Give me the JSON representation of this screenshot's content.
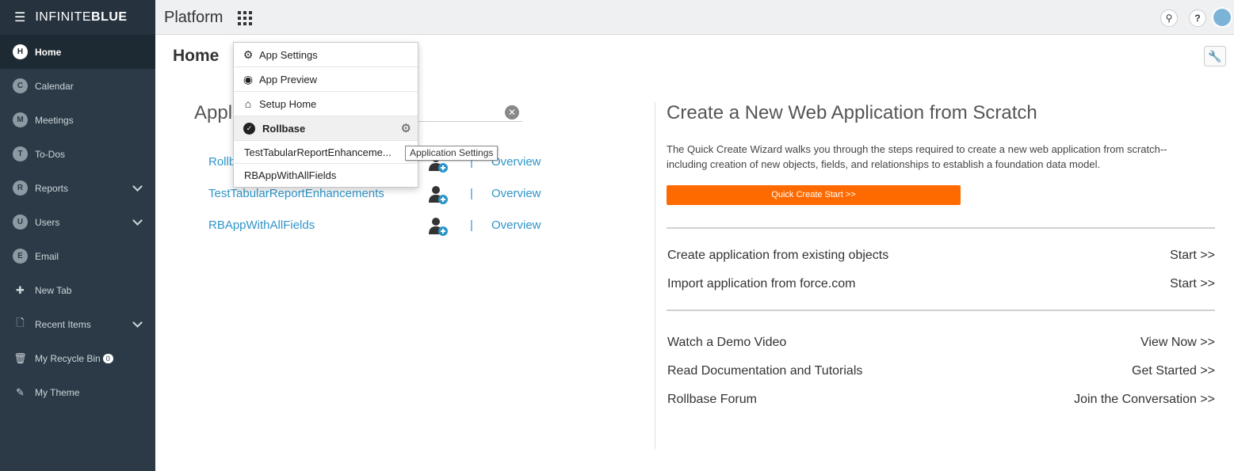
{
  "brand": {
    "menu_icon": "hamburger-icon",
    "name_prefix": "INFINITE",
    "name_suffix": "BLUE"
  },
  "sidebar": {
    "items": [
      {
        "letter": "H",
        "label": "Home"
      },
      {
        "letter": "C",
        "label": "Calendar"
      },
      {
        "letter": "M",
        "label": "Meetings"
      },
      {
        "letter": "T",
        "label": "To-Dos"
      },
      {
        "letter": "R",
        "label": "Reports"
      },
      {
        "letter": "U",
        "label": "Users"
      },
      {
        "letter": "E",
        "label": "Email"
      },
      {
        "icon": "plus-icon",
        "label": "New Tab"
      },
      {
        "icon": "file-icon",
        "label": "Recent Items"
      },
      {
        "icon": "trash-icon",
        "label": "My Recycle Bin",
        "badge": "0"
      },
      {
        "icon": "edit-icon",
        "label": "My Theme"
      }
    ]
  },
  "topbar": {
    "title": "Platform",
    "help": "?"
  },
  "main": {
    "page_title": "Home",
    "apps_heading": "Appl",
    "apps": [
      {
        "name": "Rollb",
        "sep": "|",
        "overview": "Overview"
      },
      {
        "name": "TestTabularReportEnhancements",
        "sep": "|",
        "overview": "Overview"
      },
      {
        "name": "RBAppWithAllFields",
        "sep": "|",
        "overview": "Overview"
      }
    ]
  },
  "right": {
    "title": "Create a New Web Application from Scratch",
    "description": "The Quick Create Wizard walks you through the steps required to create a new web application from scratch--including creation of new objects, fields, and relationships to establish a foundation data model.",
    "quick_create_label": "Quick Create Start >>",
    "rows1": [
      {
        "label": "Create application from existing objects",
        "action": "Start >>"
      },
      {
        "label": "Import application from force.com",
        "action": "Start >>"
      }
    ],
    "rows2": [
      {
        "label": "Watch a Demo Video",
        "action": "View Now >>"
      },
      {
        "label": "Read Documentation and Tutorials",
        "action": "Get Started >>"
      },
      {
        "label": "Rollbase Forum",
        "action": "Join the Conversation >>"
      }
    ]
  },
  "dropdown": {
    "app_settings": "App Settings",
    "app_preview": "App Preview",
    "setup_home": "Setup Home",
    "selected_app": "Rollbase",
    "sub1": "TestTabularReportEnhanceme...",
    "sub2": "RBAppWithAllFields"
  },
  "tooltip": "Application Settings",
  "colors": {
    "sidebar": "#2b3a46",
    "accent": "#ff6a00",
    "link": "#2f95c8"
  }
}
